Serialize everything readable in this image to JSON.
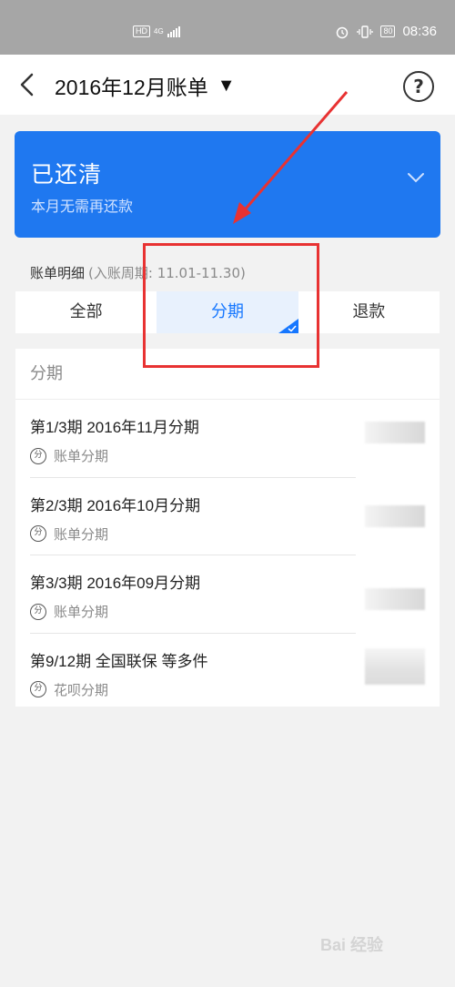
{
  "status_bar": {
    "network": "HD",
    "signal": "4G",
    "battery": "80",
    "time": "08:36"
  },
  "header": {
    "title": "2016年12月账单",
    "title_caret": "▼",
    "help": "?"
  },
  "status_card": {
    "title": "已还清",
    "subtitle": "本月无需再还款"
  },
  "details": {
    "label": "账单明细",
    "period": "(入账周期: 11.01-11.30)"
  },
  "tabs": [
    {
      "label": "全部",
      "active": false
    },
    {
      "label": "分期",
      "active": true
    },
    {
      "label": "退款",
      "active": false
    }
  ],
  "list": {
    "header": "分期",
    "items": [
      {
        "title": "第1/3期 2016年11月分期",
        "type": "账单分期",
        "icon": "分"
      },
      {
        "title": "第2/3期 2016年10月分期",
        "type": "账单分期",
        "icon": "分"
      },
      {
        "title": "第3/3期 2016年09月分期",
        "type": "账单分期",
        "icon": "分"
      },
      {
        "title": "第9/12期 全国联保 等多件",
        "type": "花呗分期",
        "icon": "分"
      }
    ]
  },
  "watermark": "Bai 经验",
  "colors": {
    "primary": "#1f78f0",
    "tab_active_bg": "#e8f1fd",
    "annotation": "#e83232"
  }
}
